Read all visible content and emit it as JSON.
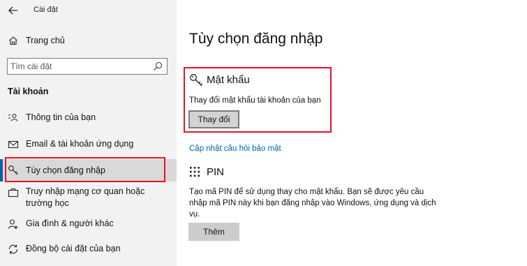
{
  "window": {
    "title": "Cài đặt"
  },
  "sidebar": {
    "home": "Trang chủ",
    "search_placeholder": "Tìm cài đặt",
    "section": "Tài khoản",
    "items": [
      {
        "label": "Thông tin của bạn",
        "icon": "person-card-icon"
      },
      {
        "label": "Email & tài khoản ứng dụng",
        "icon": "mail-icon"
      },
      {
        "label": "Tùy chọn đăng nhập",
        "icon": "key-icon",
        "active": true
      },
      {
        "label": "Truy nhập mạng cơ quan hoặc trường học",
        "icon": "briefcase-icon"
      },
      {
        "label": "Gia đình & người khác",
        "icon": "people-icon"
      },
      {
        "label": "Đồng bộ cài đặt của bạn",
        "icon": "sync-icon"
      }
    ]
  },
  "main": {
    "title": "Tùy chọn đăng nhập",
    "password": {
      "heading": "Mật khẩu",
      "description": "Thay đổi mật khẩu tài khoản của bạn",
      "button": "Thay đổi"
    },
    "security_link": "Cập nhật câu hỏi bảo mật",
    "pin": {
      "heading": "PIN",
      "description": "Tạo mã PIN để sử dụng thay cho mật khẩu. Bạn sẽ được yêu cầu nhập mã PIN này khi bạn đăng nhập vào Windows, ứng dụng và dịch vụ.",
      "button": "Thêm"
    }
  },
  "colors": {
    "accent": "#0063b1",
    "highlight": "#e81123",
    "sidebar": "#f2f2f2"
  }
}
